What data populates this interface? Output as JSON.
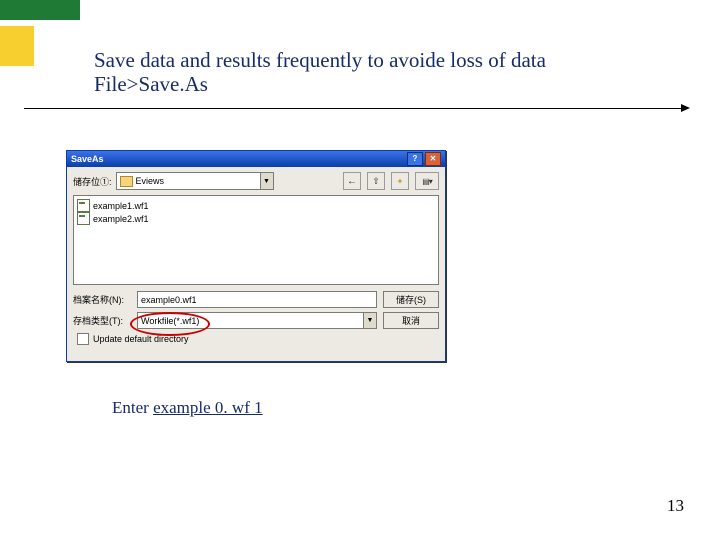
{
  "heading": {
    "line1": "Save data and results frequently to avoide loss of data",
    "line2": "File>Save.As"
  },
  "dialog": {
    "title": "SaveAs",
    "savein_label": "储存位①:",
    "savein_value": "Eviews",
    "files": [
      "example1.wf1",
      "example2.wf1"
    ],
    "filename_label": "档案名称(N):",
    "filename_value": "example0.wf1",
    "filetype_label": "存档类型(T):",
    "filetype_value": "Workfile(*.wf1)",
    "save_btn": "储存(S)",
    "cancel_btn": "取消",
    "update_label": "Update default directory"
  },
  "caption_prefix": "Enter ",
  "caption_filename": "example 0. wf 1",
  "page_number": "13"
}
